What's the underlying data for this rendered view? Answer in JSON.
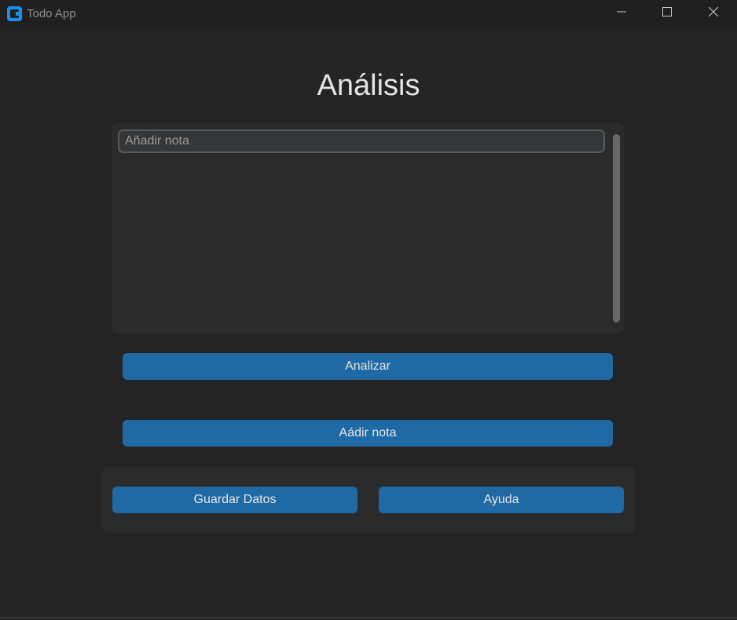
{
  "window": {
    "title": "Todo App"
  },
  "page": {
    "title": "Análisis"
  },
  "notes": {
    "input_placeholder": "Añadir nota",
    "input_value": ""
  },
  "buttons": {
    "analizar": "Analizar",
    "add_note": "Aádir nota",
    "guardar": "Guardar Datos",
    "ayuda": "Ayuda"
  },
  "colors": {
    "accent": "#1f6aa5",
    "background": "#242424",
    "frame": "#2b2b2b",
    "app_icon": "#1c8df0"
  },
  "icons": {
    "app": "app-logo-icon",
    "minimize": "minimize-icon",
    "maximize": "maximize-icon",
    "close": "close-icon"
  }
}
